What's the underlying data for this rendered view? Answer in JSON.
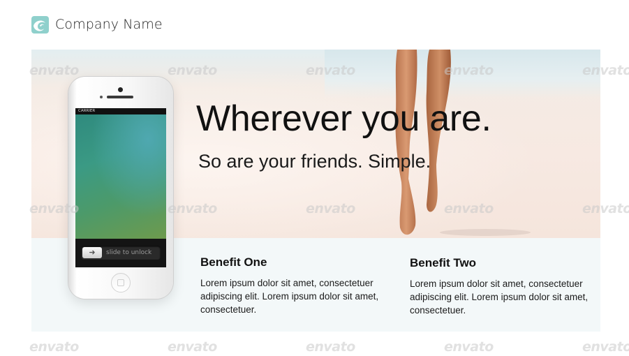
{
  "header": {
    "company_name": "Company Name",
    "logo_icon": "swirl-logo-icon",
    "logo_color": "#8fd0cc"
  },
  "hero": {
    "headline": "Wherever you are.",
    "subline": "So are your friends. Simple."
  },
  "phone": {
    "carrier": "CARRIER",
    "slide_label": "slide to unlock",
    "slide_icon": "arrow-right-icon"
  },
  "benefits": [
    {
      "title": "Benefit One",
      "text": "Lorem ipsum dolor sit amet, consectetuer adipiscing elit. Lorem ipsum dolor sit amet, consectetuer."
    },
    {
      "title": "Benefit Two",
      "text": "Lorem ipsum dolor sit amet, consectetuer adipiscing elit. Lorem ipsum dolor sit amet, consectetuer."
    }
  ],
  "watermark": {
    "text": "envato"
  },
  "colors": {
    "lower_panel": "#f3f8f9",
    "text": "#111111"
  }
}
